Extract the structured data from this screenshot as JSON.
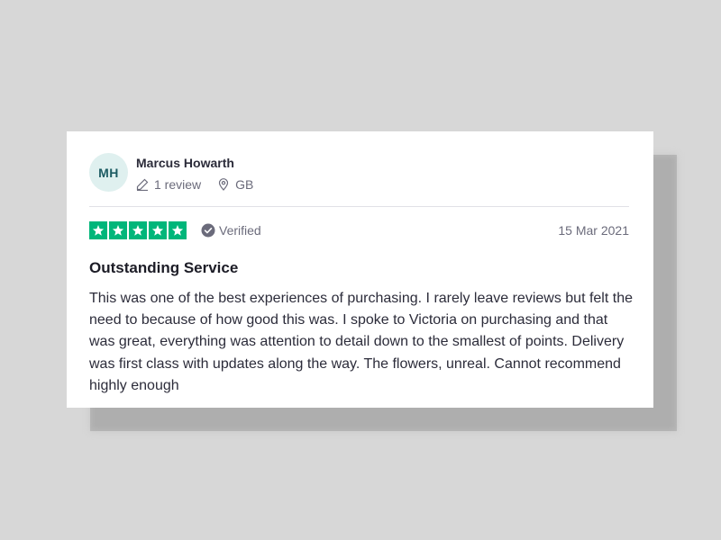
{
  "reviewer": {
    "initials": "MH",
    "name": "Marcus Howarth",
    "review_count": "1 review",
    "country": "GB"
  },
  "rating": {
    "stars": 5,
    "max_stars": 5,
    "star_color": "#00b67a",
    "verified_label": "Verified",
    "date": "15 Mar 2021"
  },
  "review": {
    "title": "Outstanding Service",
    "body": "This was one of the best experiences of purchasing. I rarely leave reviews but felt the need to because of how good this was. I spoke to Victoria on purchasing and that was great, everything was attention to detail down to the smallest of points. Delivery was first class with updates along the way. The flowers, unreal. Cannot recommend highly enough"
  },
  "icons": {
    "review_count": "pencil-icon",
    "country": "location-pin-icon",
    "verified": "check-circle-icon",
    "star": "star-icon"
  }
}
